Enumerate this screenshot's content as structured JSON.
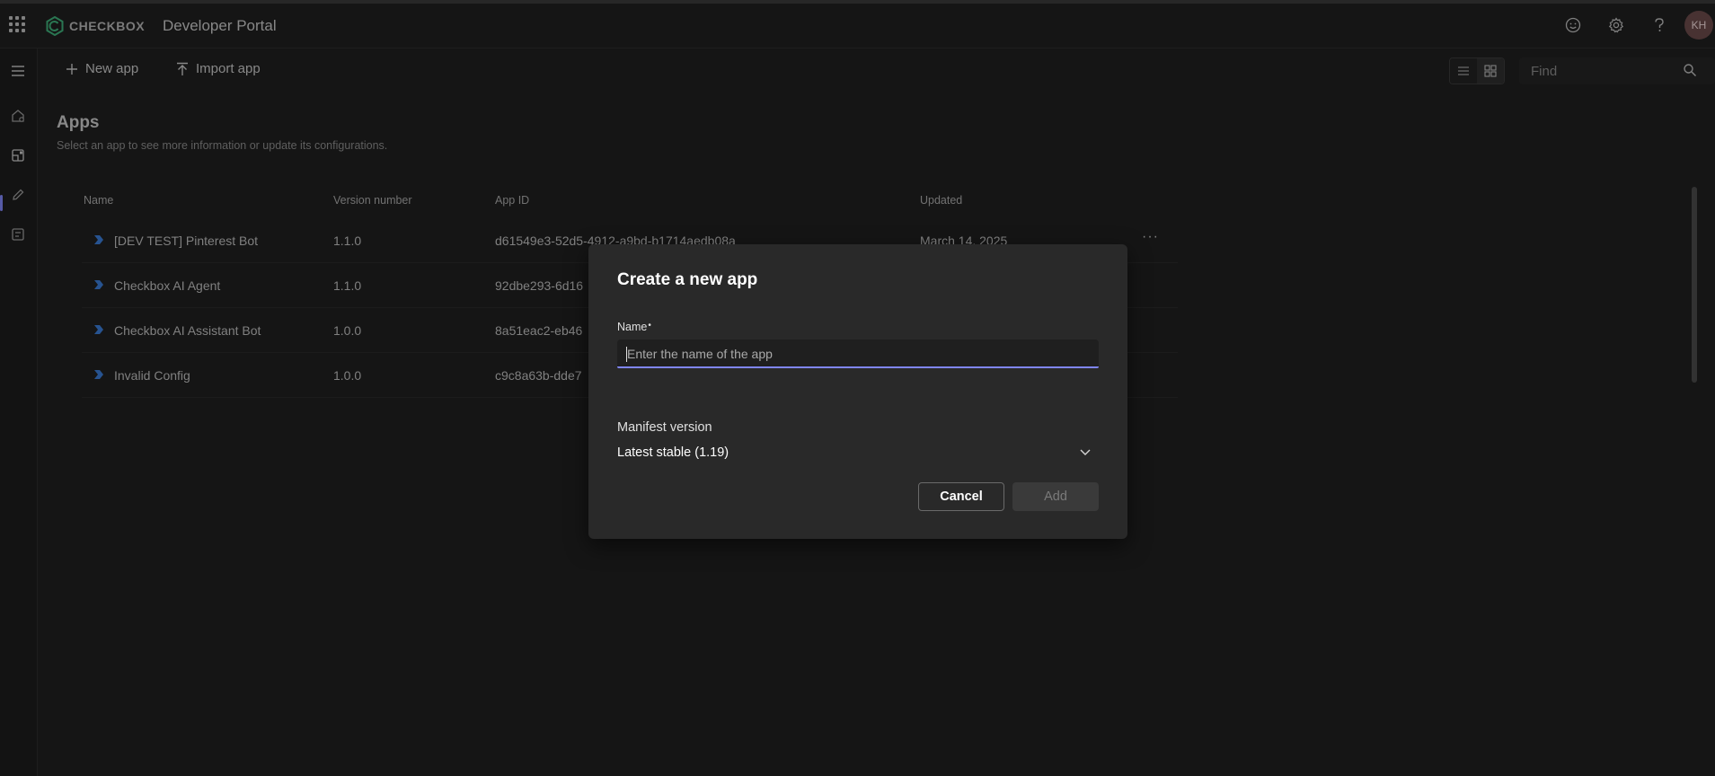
{
  "header": {
    "brand": "CHECKBOX",
    "title": "Developer Portal",
    "avatar_initials": "KH",
    "icons": [
      "apps-waffle-icon",
      "smiley-feedback-icon",
      "gear-icon",
      "help-icon"
    ]
  },
  "rail": {
    "icons": [
      "hamburger-icon",
      "home-icon",
      "apps-icon",
      "pencil-icon",
      "tools-icon"
    ]
  },
  "toolbar": {
    "new_app": "New app",
    "import_app": "Import app",
    "find_placeholder": "Find"
  },
  "page": {
    "title": "Apps",
    "subtitle": "Select an app to see more information or update its configurations."
  },
  "table": {
    "columns": [
      "Name",
      "Version number",
      "App ID",
      "Updated"
    ],
    "rows": [
      {
        "name": "[DEV TEST] Pinterest Bot",
        "version": "1.1.0",
        "app_id": "d61549e3-52d5-4912-a9bd-b1714aedb08a",
        "updated": "March 14, 2025"
      },
      {
        "name": "Checkbox AI Agent",
        "version": "1.1.0",
        "app_id": "92dbe293-6d16",
        "updated": ""
      },
      {
        "name": "Checkbox AI Assistant Bot",
        "version": "1.0.0",
        "app_id": "8a51eac2-eb46",
        "updated": ""
      },
      {
        "name": "Invalid Config",
        "version": "1.0.0",
        "app_id": "c9c8a63b-dde7",
        "updated": ""
      }
    ]
  },
  "dialog": {
    "title": "Create a new app",
    "name_label": "Name",
    "name_required_mark": "•",
    "name_placeholder": "Enter the name of the app",
    "manifest_label": "Manifest version",
    "manifest_value": "Latest stable (1.19)",
    "cancel": "Cancel",
    "add": "Add"
  },
  "colors": {
    "accent": "#7f85f5",
    "background": "#1f1f1f",
    "dialog_bg": "#292929"
  }
}
